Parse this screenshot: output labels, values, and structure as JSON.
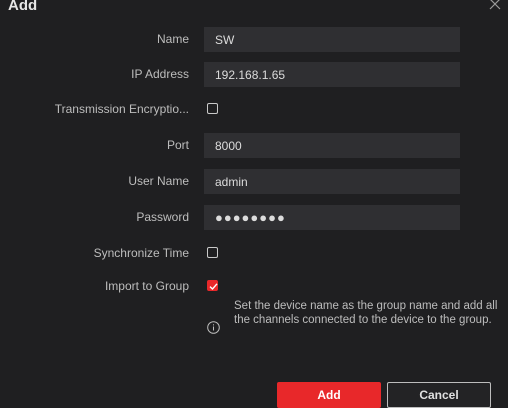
{
  "dialog": {
    "title": "Add",
    "close_icon": "close-icon"
  },
  "form": {
    "name": {
      "label": "Name",
      "value": "SW"
    },
    "ip_address": {
      "label": "IP Address",
      "value": "192.168.1.65"
    },
    "transmission_encryption": {
      "label": "Transmission Encryptio...",
      "checked": false
    },
    "port": {
      "label": "Port",
      "value": "8000"
    },
    "user_name": {
      "label": "User Name",
      "value": "admin"
    },
    "password": {
      "label": "Password",
      "value": "●●●●●●●●"
    },
    "synchronize_time": {
      "label": "Synchronize Time",
      "checked": false
    },
    "import_to_group": {
      "label": "Import to Group",
      "checked": true
    }
  },
  "hint": {
    "icon": "info-icon",
    "text": "Set the device name as the group name and add all the channels connected to the device to the group."
  },
  "buttons": {
    "add_label": "Add",
    "cancel_label": "Cancel"
  },
  "colors": {
    "background": "#1f1f21",
    "field_background": "#2f2f32",
    "accent": "#e8282a"
  }
}
